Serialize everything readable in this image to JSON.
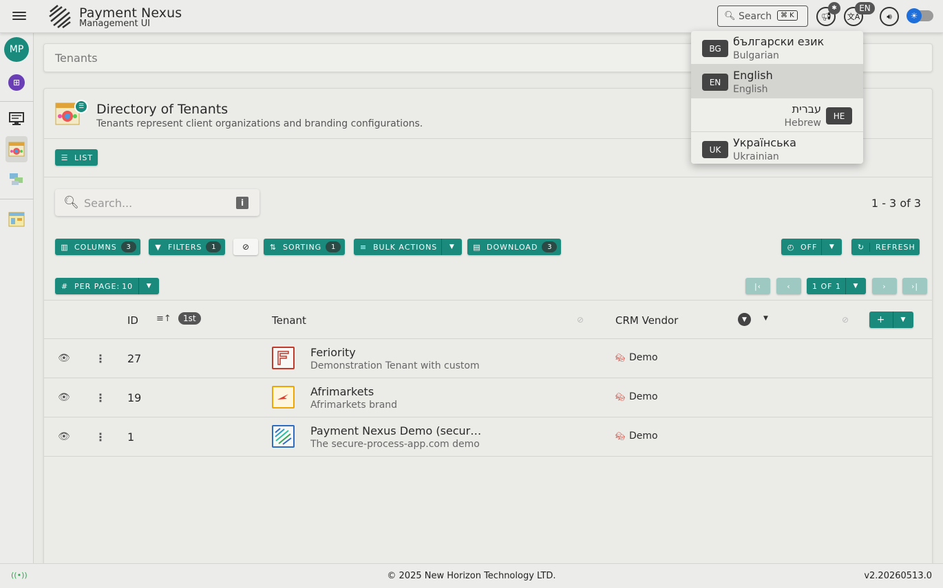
{
  "app": {
    "title": "Payment Nexus",
    "subtitle": "Management UI"
  },
  "header": {
    "search_label": "Search",
    "search_shortcut": "⌘ K",
    "language_badge": "EN"
  },
  "sidebar": {
    "avatar_initials": "MP"
  },
  "breadcrumb": {
    "current": "Tenants"
  },
  "directory": {
    "title": "Directory of Tenants",
    "subtitle": "Tenants represent client organizations and branding configurations.",
    "view_button": "LIST"
  },
  "search": {
    "placeholder": "Search..."
  },
  "range_text": "1 - 3 of 3",
  "toolbar": {
    "columns_label": "COLUMNS",
    "columns_count": "3",
    "filters_label": "FILTERS",
    "filters_count": "1",
    "sorting_label": "SORTING",
    "sorting_count": "1",
    "bulk_actions_label": "BULK ACTIONS",
    "download_label": "DOWNLOAD",
    "download_count": "3",
    "auto_refresh_label": "OFF",
    "refresh_label": "REFRESH"
  },
  "pagination": {
    "per_page_label": "PER PAGE:",
    "per_page_value": "10",
    "page_label": "1 OF 1"
  },
  "table": {
    "columns": {
      "id": "ID",
      "sort_rank": "1st",
      "tenant": "Tenant",
      "crm_vendor": "CRM Vendor"
    },
    "rows": [
      {
        "id": "27",
        "name": "Feriority",
        "description": "Demonstration Tenant with customi",
        "crm": "Demo"
      },
      {
        "id": "19",
        "name": "Afrimarkets",
        "description": "Afrimarkets brand",
        "crm": "Demo"
      },
      {
        "id": "1",
        "name": "Payment Nexus Demo (secur…",
        "description": "The secure-process-app.com demo",
        "crm": "Demo"
      }
    ]
  },
  "languages": [
    {
      "code": "BG",
      "native": "български език",
      "english": "Bulgarian",
      "selected": false,
      "rtl": false
    },
    {
      "code": "EN",
      "native": "English",
      "english": "English",
      "selected": true,
      "rtl": false
    },
    {
      "code": "HE",
      "native": "עברית",
      "english": "Hebrew",
      "selected": false,
      "rtl": true
    },
    {
      "code": "UK",
      "native": "Українська",
      "english": "Ukrainian",
      "selected": false,
      "rtl": false
    }
  ],
  "footer": {
    "copyright": "© 2025 New Horizon Technology LTD.",
    "version": "v2.20260513.0"
  },
  "colors": {
    "accent": "#1a8a7c",
    "accent_light": "#9dc9c2",
    "theme_toggle": "#1e6fd9"
  }
}
